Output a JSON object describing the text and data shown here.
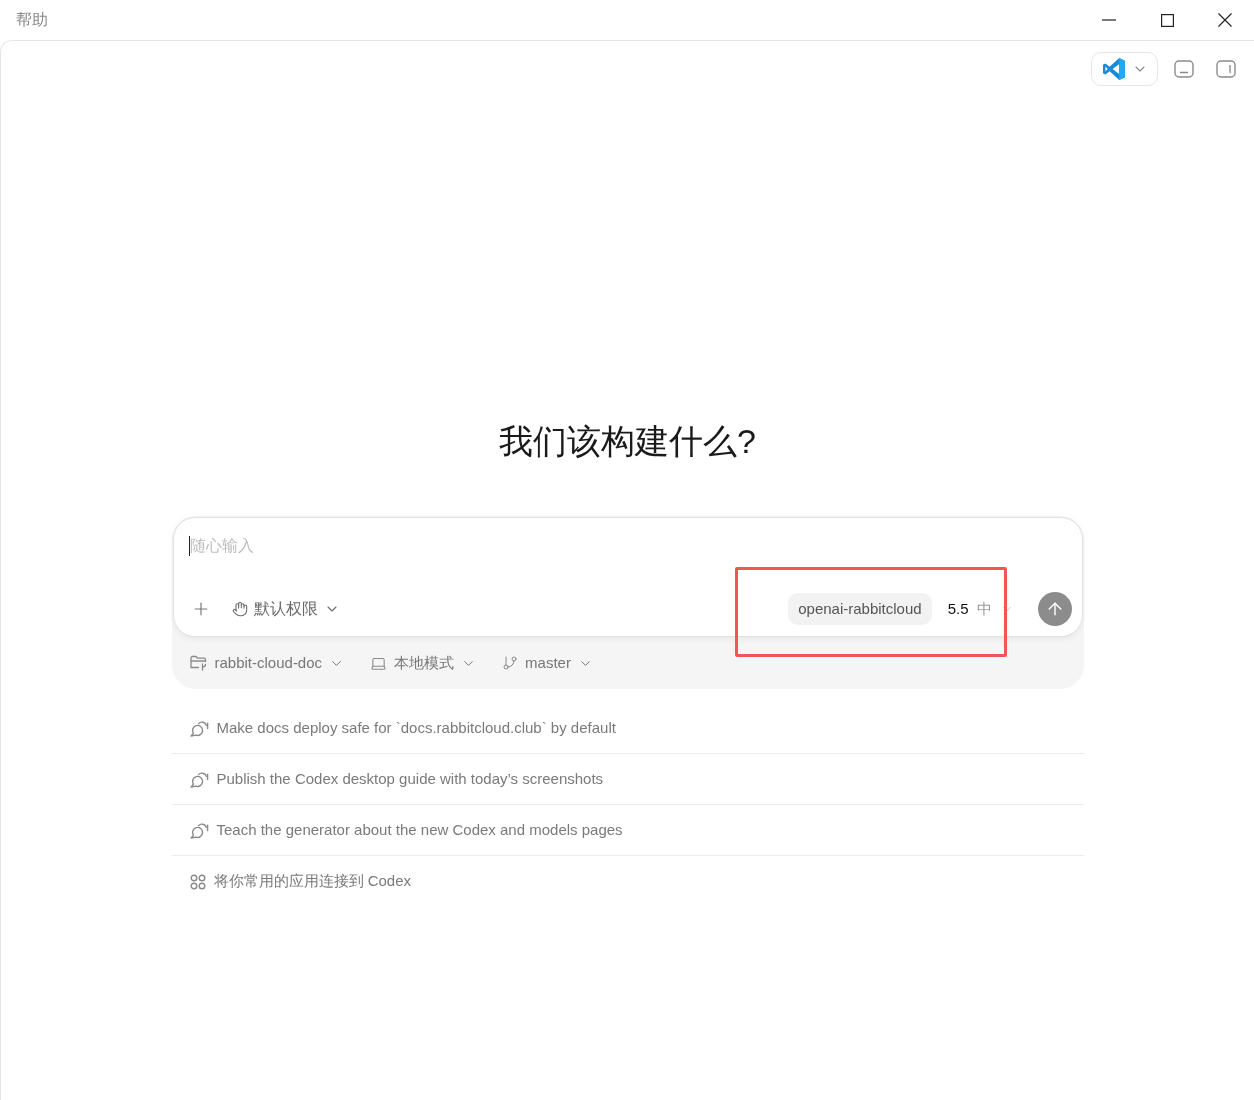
{
  "window": {
    "title": "帮助"
  },
  "heading": "我们该构建什么?",
  "composer": {
    "placeholder": "随心输入",
    "permissions": "默认权限",
    "model": "openai-rabbitcloud",
    "version": "5.5",
    "effort": "中",
    "highlighted": true
  },
  "context": [
    {
      "kind": "folder",
      "label": "rabbit-cloud-doc"
    },
    {
      "kind": "environment",
      "label": "本地模式"
    },
    {
      "kind": "branch",
      "label": "master"
    }
  ],
  "suggestions": [
    {
      "kind": "task",
      "text": "Make docs deploy safe for `docs.rabbitcloud.club` by default"
    },
    {
      "kind": "task",
      "text": "Publish the Codex desktop guide with today’s screenshots"
    },
    {
      "kind": "task",
      "text": "Teach the generator about the new Codex and models pages"
    },
    {
      "kind": "apps",
      "text": "将你常用的应用连接到 Codex"
    }
  ]
}
